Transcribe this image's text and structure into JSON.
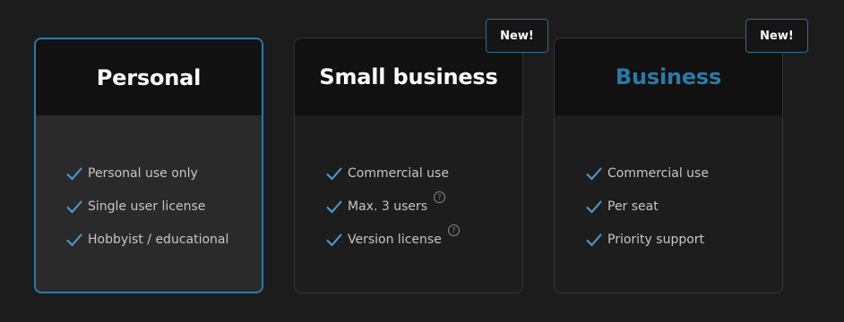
{
  "plans": [
    {
      "title": "Personal",
      "selected": true,
      "features": [
        {
          "label": "Personal use only"
        },
        {
          "label": "Single user license"
        },
        {
          "label": "Hobbyist / educational"
        }
      ]
    },
    {
      "title": "Small business",
      "badge": "New!",
      "features": [
        {
          "label": "Commercial use"
        },
        {
          "label": "Max. 3 users",
          "help_icon": "question-circle-icon",
          "help_glyph": "?"
        },
        {
          "label": "Version license",
          "help_icon": "question-circle-icon",
          "help_glyph": "?"
        }
      ]
    },
    {
      "title": "Business",
      "title_color": "#2a7aa8",
      "badge": "New!",
      "features": [
        {
          "label": "Commercial use"
        },
        {
          "label": "Per seat"
        },
        {
          "label": "Priority support"
        }
      ]
    }
  ],
  "colors": {
    "accent": "#2a7aa8",
    "check": "#4a9fd6",
    "background": "#1c1c1c"
  },
  "icons": {
    "check": "check-icon"
  }
}
